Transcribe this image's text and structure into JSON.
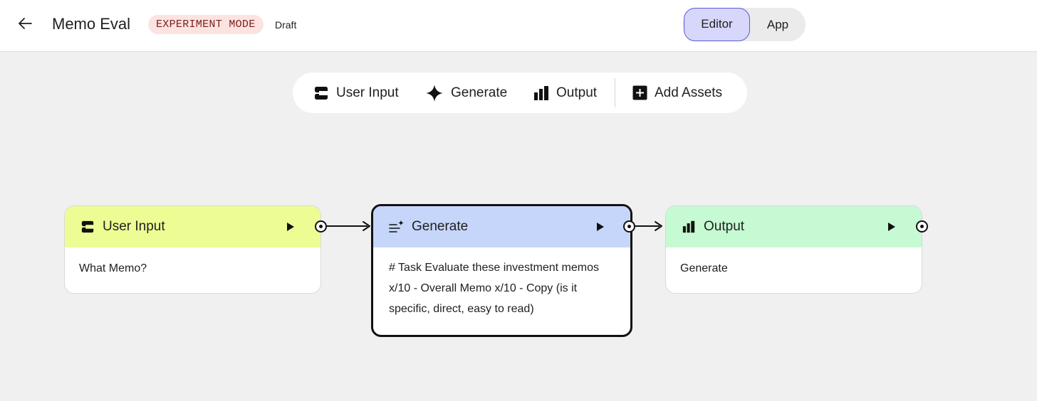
{
  "header": {
    "title": "Memo Eval",
    "badge": "EXPERIMENT MODE",
    "status": "Draft",
    "back_icon": "arrow-left-icon",
    "modes": [
      {
        "label": "Editor",
        "active": true
      },
      {
        "label": "App",
        "active": false
      }
    ]
  },
  "toolbar": {
    "items": [
      {
        "label": "User Input",
        "icon": "user-input-icon"
      },
      {
        "label": "Generate",
        "icon": "sparkle-icon"
      },
      {
        "label": "Output",
        "icon": "output-chart-icon"
      },
      {
        "label": "Add Assets",
        "icon": "add-box-icon"
      }
    ]
  },
  "nodes": [
    {
      "title": "User Input",
      "body": "What Memo?",
      "icon": "user-input-icon",
      "color": "#eefc94",
      "selected": false
    },
    {
      "title": "Generate",
      "body": "# Task Evaluate these investment memos x/10 - Overall Memo x/10 - Copy (is it specific, direct, easy to read)",
      "icon": "generate-text-icon",
      "color": "#c5d6fa",
      "selected": true
    },
    {
      "title": "Output",
      "body": "Generate",
      "icon": "output-chart-icon",
      "color": "#c5fad3",
      "selected": false
    }
  ],
  "colors": {
    "canvas": "#f0f0f0",
    "badge_bg": "#fbe3e1",
    "badge_text": "#7a1f1c",
    "editor_active": "#d6d7fb",
    "editor_border": "#5b5bd6"
  }
}
